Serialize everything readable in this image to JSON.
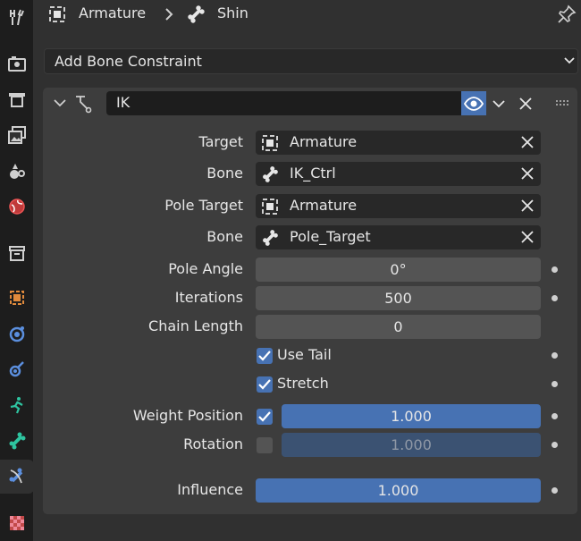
{
  "header": {
    "object": "Armature",
    "bone": "Shin"
  },
  "add_constraint": {
    "label": "Add Bone Constraint"
  },
  "constraint": {
    "name": "IK",
    "target_label": "Target",
    "target_value": "Armature",
    "bone_label": "Bone",
    "bone_value": "IK_Ctrl",
    "pole_target_label": "Pole Target",
    "pole_target_value": "Armature",
    "pole_bone_label": "Bone",
    "pole_bone_value": "Pole_Target",
    "pole_angle_label": "Pole Angle",
    "pole_angle_value": "0°",
    "iterations_label": "Iterations",
    "iterations_value": "500",
    "chain_length_label": "Chain Length",
    "chain_length_value": "0",
    "use_tail_label": "Use Tail",
    "use_tail": true,
    "stretch_label": "Stretch",
    "stretch": true,
    "weight_position_label": "Weight Position",
    "weight_position_value": "1.000",
    "weight_position_enabled": true,
    "rotation_label": "Rotation",
    "rotation_value": "1.000",
    "rotation_enabled": false,
    "influence_label": "Influence",
    "influence_value": "1.000"
  },
  "colors": {
    "accent": "#4772b3",
    "panel": "#3d3d3d",
    "background": "#303030",
    "tabbar": "#1d1d1d"
  },
  "tabs": [
    "tool-icon",
    "render-icon",
    "output-icon",
    "view-layer-icon",
    "scene-icon",
    "world-icon",
    "collection-icon",
    "object-icon",
    "modifier-icon",
    "particles-icon",
    "physics-icon",
    "object-data-icon",
    "bone-icon",
    "bone-constraint-icon",
    "texture-icon"
  ]
}
